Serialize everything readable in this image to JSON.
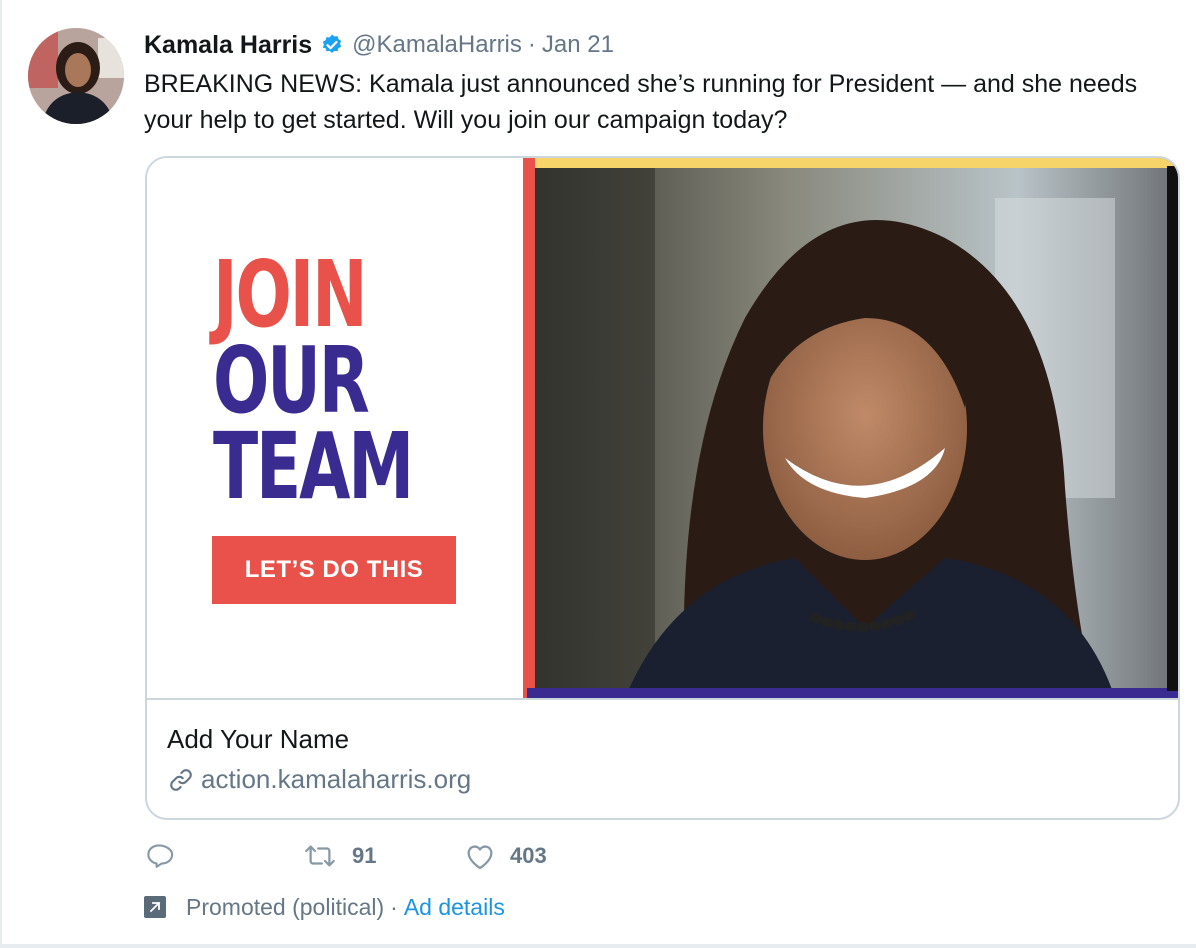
{
  "author": {
    "name": "Kamala Harris",
    "handle": "@KamalaHarris",
    "separator": "·",
    "date": "Jan 21",
    "verified": true
  },
  "tweet": {
    "text": "BREAKING NEWS: Kamala just announced she’s running for President — and she needs your help to get started. Will you join our campaign today?"
  },
  "card": {
    "headline": [
      "JOIN",
      "OUR",
      "TEAM"
    ],
    "cta_label": "LET’S DO THIS",
    "title": "Add Your Name",
    "url": "action.kamalaharris.org"
  },
  "actions": {
    "replies": "",
    "retweets": "91",
    "likes": "403"
  },
  "promoted": {
    "label": "Promoted (political)",
    "separator": "·",
    "ad_details": "Ad details"
  },
  "colors": {
    "accent_red": "#e8524a",
    "accent_purple": "#3a2b91",
    "accent_gold": "#f6d46a",
    "link_blue": "#1b95e0",
    "muted_gray": "#657786",
    "verified_blue": "#1da1f2"
  },
  "icons": [
    "verified-badge-icon",
    "reply-icon",
    "retweet-icon",
    "like-icon",
    "link-icon",
    "promoted-icon"
  ]
}
